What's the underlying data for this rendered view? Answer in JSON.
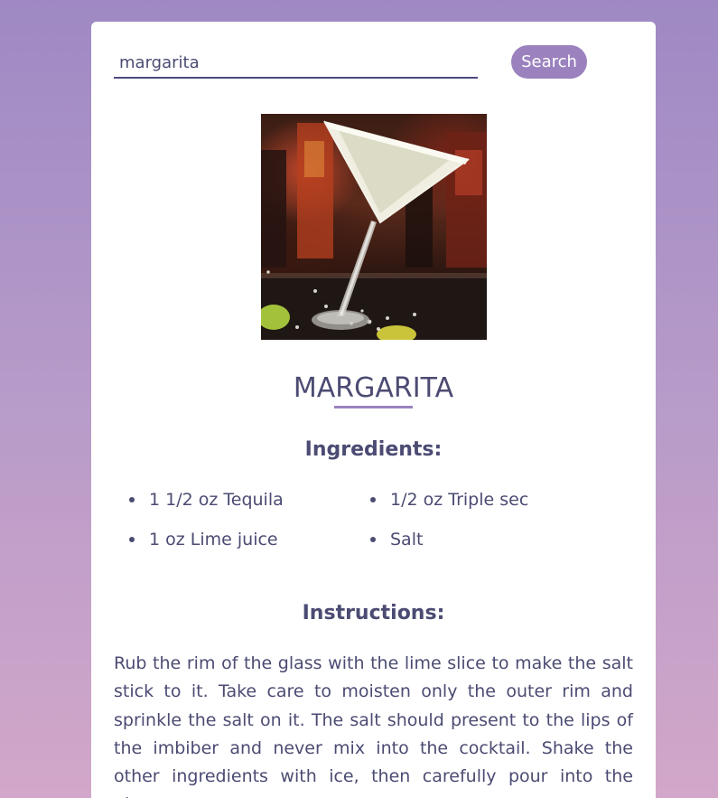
{
  "search": {
    "value": "margarita",
    "button_label": "Search"
  },
  "drink": {
    "image_icon": "margarita-glass-photo",
    "title": "MARGARITA",
    "ingredients_heading": "Ingredients:",
    "ingredients": [
      "1 1/2 oz Tequila",
      "1/2 oz Triple sec",
      "1 oz Lime juice",
      "Salt"
    ],
    "instructions_heading": "Instructions:",
    "instructions": "Rub the rim of the glass with the lime slice to make the salt stick to it. Take care to moisten only the outer rim and sprinkle the salt on it. The salt should present to the lips of the imbiber and never mix into the cocktail. Shake the other ingredients with ice, then carefully pour into the glass."
  },
  "colors": {
    "accent": "#9b82bf",
    "text": "#4b4b73",
    "input_underline": "#4d4a7e",
    "background_top": "#9f89c4",
    "background_bottom": "#d2a7c9",
    "card": "#ffffff"
  }
}
